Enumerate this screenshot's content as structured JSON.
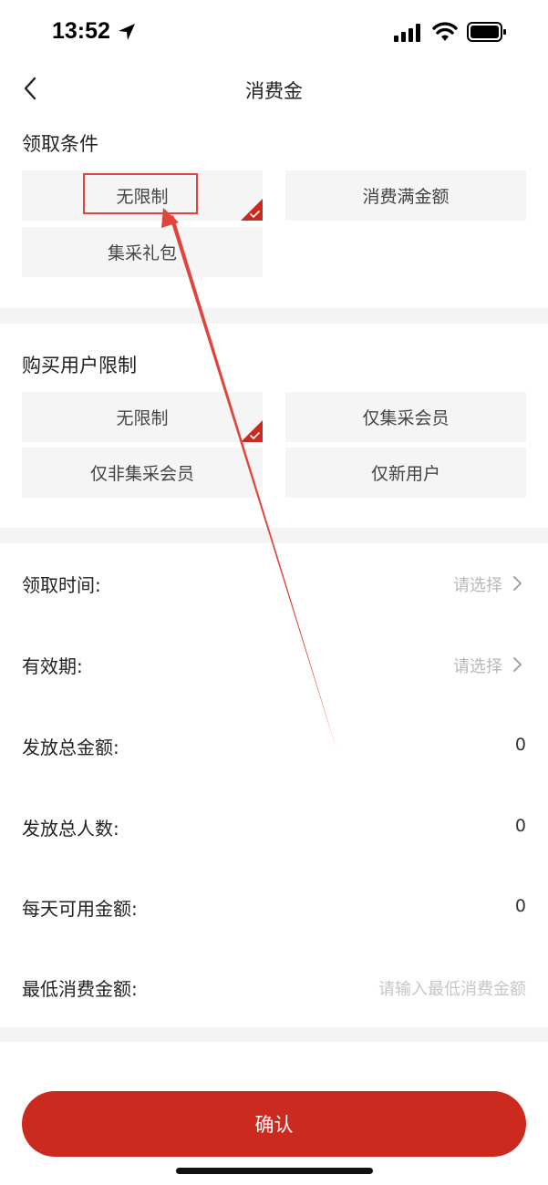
{
  "status_bar": {
    "time": "13:52"
  },
  "nav": {
    "title": "消费金"
  },
  "claim_conditions": {
    "title": "领取条件",
    "options": [
      {
        "label": "无限制",
        "selected": true
      },
      {
        "label": "消费满金额",
        "selected": false
      },
      {
        "label": "集采礼包",
        "selected": false
      }
    ]
  },
  "buyer_limit": {
    "title": "购买用户限制",
    "options": [
      {
        "label": "无限制",
        "selected": true
      },
      {
        "label": "仅集采会员",
        "selected": false
      },
      {
        "label": "仅非集采会员",
        "selected": false
      },
      {
        "label": "仅新用户",
        "selected": false
      }
    ]
  },
  "form": {
    "claim_time": {
      "label": "领取时间:",
      "value": "请选择"
    },
    "validity": {
      "label": "有效期:",
      "value": "请选择"
    },
    "total_amount": {
      "label": "发放总金额:",
      "value": "0"
    },
    "total_people": {
      "label": "发放总人数:",
      "value": "0"
    },
    "daily_amount": {
      "label": "每天可用金额:",
      "value": "0"
    },
    "min_spend": {
      "label": "最低消费金额:",
      "placeholder": "请输入最低消费金额"
    }
  },
  "confirm_label": "确认",
  "colors": {
    "accent": "#cc2a1e",
    "annotation": "#e0443a"
  }
}
